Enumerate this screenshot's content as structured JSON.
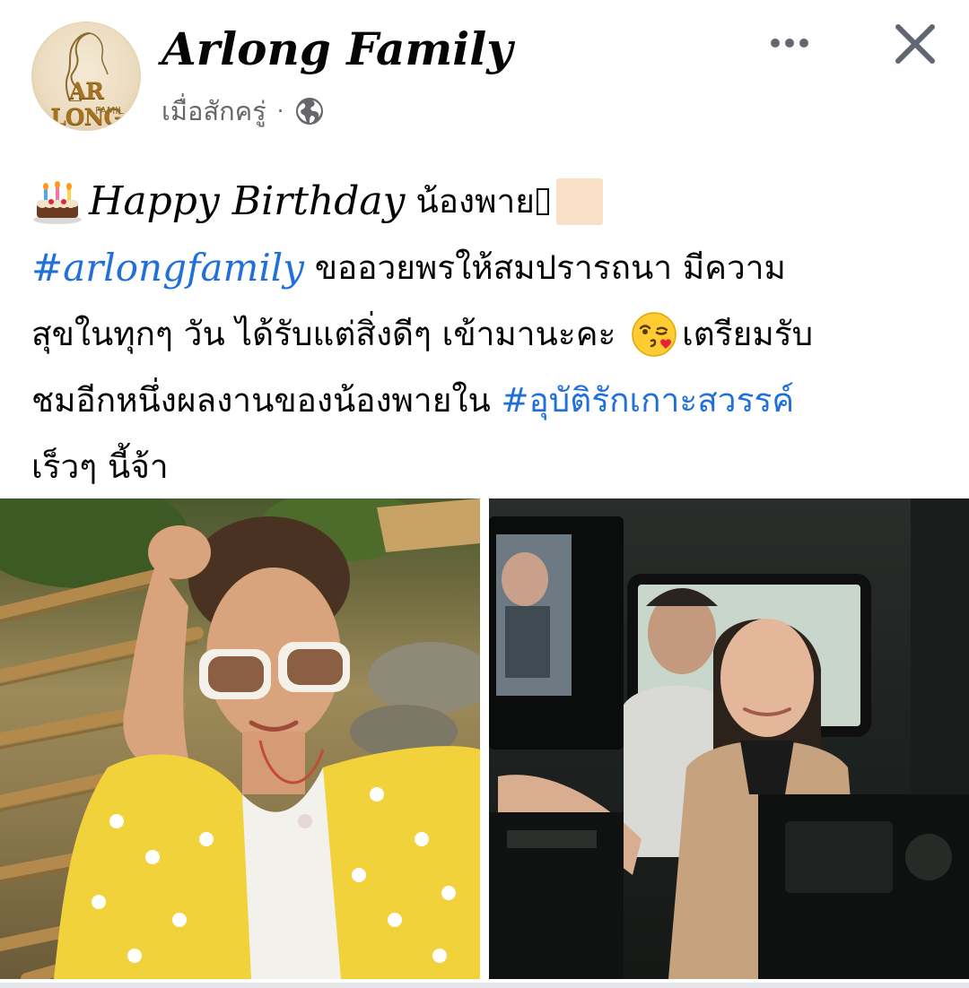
{
  "post": {
    "page_name": "Arlong Family",
    "timestamp": "เมื่อสักครู่",
    "separator": "·",
    "privacy_icon": "globe-icon",
    "avatar": {
      "logo_text": "AR LONG",
      "logo_sub": "FAMIL"
    },
    "actions": {
      "more_icon": "more-dots-icon",
      "close_icon": "close-icon"
    }
  },
  "caption": {
    "line1": {
      "icon": "birthday-cake-icon",
      "greeting": "Happy Birthday",
      "name": "น้องพาย"
    },
    "line2": {
      "hashtag": "#arlongfamily",
      "text": " ขออวยพรให้สมปรารถนา มีความ"
    },
    "line3": {
      "text_before": "สุขในทุกๆ วัน ได้รับแต่สิ่งดีๆ เข้ามานะคะ ",
      "icon": "face-blowing-kiss-icon",
      "text_after": "เตรียมรับ"
    },
    "line4": {
      "text": "ชมอีกหนึ่งผลงานของน้องพายใน ",
      "hashtag": "#อุบัติรักเกาะสวรรค์"
    },
    "line5": {
      "text": "เร็วๆ นี้จ้า"
    }
  },
  "photos": [
    {
      "description_icon": "photo-woman-yellow-cardigan"
    },
    {
      "description_icon": "photo-behind-the-scenes-car"
    }
  ],
  "colors": {
    "hashtag": "#216fdb",
    "secondary_text": "#65676b",
    "primary_text": "#050505"
  }
}
